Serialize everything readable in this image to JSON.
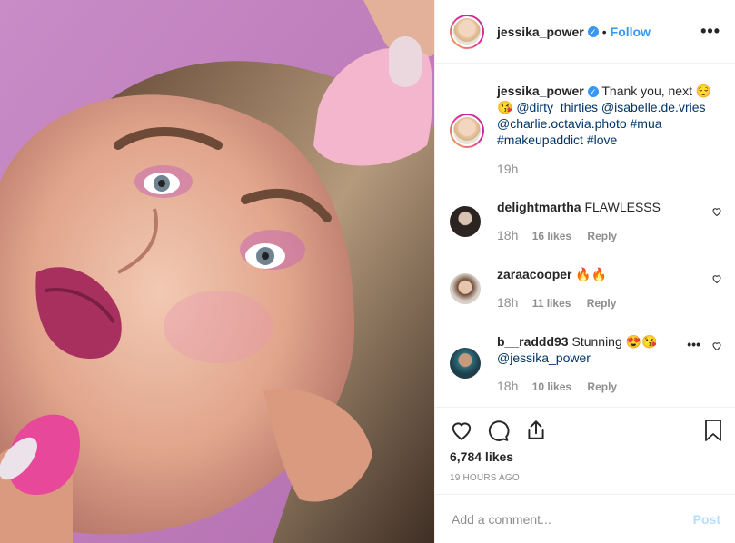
{
  "header": {
    "username": "jessika_power",
    "verified_symbol": "✓",
    "separator": "•",
    "follow_label": "Follow",
    "more_label": "•••"
  },
  "caption": {
    "username": "jessika_power",
    "text": " Thank you, next 😌😘 ",
    "mention1": "@dirty_thirties",
    "mention2": "@isabelle.de.vries",
    "mention3": "@charlie.octavia.photo",
    "tag1": "#mua",
    "tag2": "#makeupaddict",
    "tag3": "#love",
    "time": "19h"
  },
  "comments": [
    {
      "username": "delightmartha",
      "text": " FLAWLESSS",
      "time": "18h",
      "likes": "16 likes",
      "reply": "Reply"
    },
    {
      "username": "zaraacooper",
      "text": " 🔥🔥",
      "time": "18h",
      "likes": "11 likes",
      "reply": "Reply"
    },
    {
      "username": "b__raddd93",
      "text": " Stunning 😍😘",
      "mention": "@jessika_power",
      "time": "18h",
      "likes": "10 likes",
      "reply": "Reply",
      "more": "•••"
    }
  ],
  "actions": {
    "likes": "6,784 likes",
    "posted": "19 HOURS AGO"
  },
  "add_comment": {
    "placeholder": "Add a comment...",
    "post_label": "Post"
  },
  "colors": {
    "accent": "#3897f0",
    "post_disabled": "#b2dffc",
    "photo_bg": "#c77fc0"
  }
}
